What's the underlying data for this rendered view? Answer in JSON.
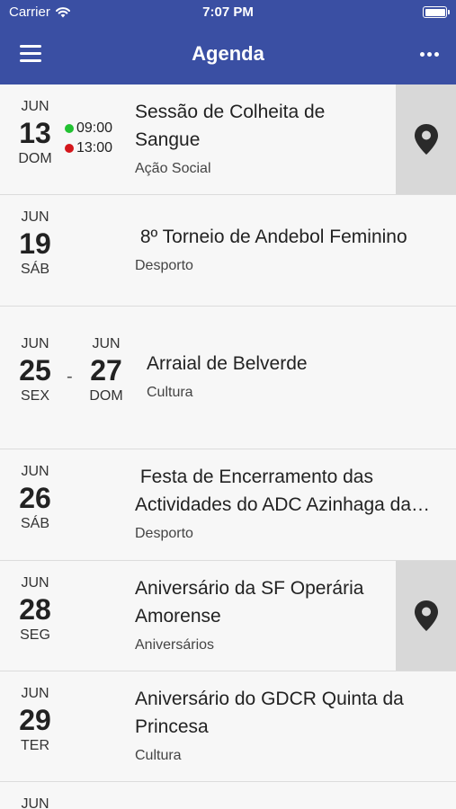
{
  "status_bar": {
    "carrier": "Carrier",
    "time": "7:07 PM"
  },
  "header": {
    "title": "Agenda"
  },
  "events": [
    {
      "month": "JUN",
      "day": "13",
      "weekday": "DOM",
      "start_time": "09:00",
      "end_time": "13:00",
      "start_color": "#22c232",
      "end_color": "#d4161b",
      "title": "Sessão de Colheita de Sangue",
      "category": "Ação Social",
      "has_location": true
    },
    {
      "month": "JUN",
      "day": "19",
      "weekday": "SÁB",
      "title": " 8º Torneio de Andebol Feminino",
      "category": "Desporto"
    },
    {
      "month": "JUN",
      "day": "25",
      "weekday": "SEX",
      "end_month": "JUN",
      "end_day": "27",
      "end_weekday": "DOM",
      "separator": "-",
      "title": "Arraial de Belverde",
      "category": "Cultura"
    },
    {
      "month": "JUN",
      "day": "26",
      "weekday": "SÁB",
      "title": " Festa de Encerramento das Actividades do ADC Azinhaga da…",
      "category": "Desporto"
    },
    {
      "month": "JUN",
      "day": "28",
      "weekday": "SEG",
      "title": "Aniversário da SF Operária Amorense",
      "category": "Aniversários",
      "has_location": true
    },
    {
      "month": "JUN",
      "day": "29",
      "weekday": "TER",
      "title": "Aniversário do GDCR Quinta da Princesa",
      "category": "Cultura"
    },
    {
      "month": "JUN"
    }
  ],
  "icons": {
    "menu": "hamburger-menu-icon",
    "more": "more-dots-icon",
    "location": "map-pin-icon",
    "wifi": "wifi-icon",
    "battery": "battery-icon"
  },
  "colors": {
    "header_bg": "#3a4fa3",
    "map_button_bg": "#d8d8d8"
  }
}
